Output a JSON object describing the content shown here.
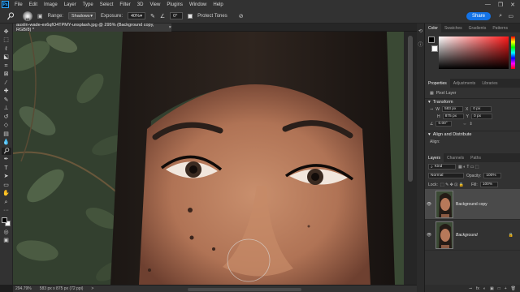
{
  "app": {
    "logo": "Ps"
  },
  "menu": [
    "File",
    "Edit",
    "Image",
    "Layer",
    "Type",
    "Select",
    "Filter",
    "3D",
    "View",
    "Plugins",
    "Window",
    "Help"
  ],
  "window_controls": [
    "—",
    "❐",
    "✕"
  ],
  "options": {
    "brush_size": "65",
    "range_label": "Range:",
    "range_value": "Shadows",
    "exposure_label": "Exposure:",
    "exposure_value": "40%",
    "angle_value": "0°",
    "protect_label": "Protect Tones",
    "share": "Share"
  },
  "tab": {
    "title": "austin-wade-ex6qfO4TPMY-unsplash.jpg @ 295% (Background copy, RGB/8) *",
    "close": "×"
  },
  "status": {
    "zoom": "294.79%",
    "dims": "583 px x 875 px (72 ppi)",
    "arrow": ">"
  },
  "panels": {
    "color_tabs": [
      "Color",
      "Swatches",
      "Gradients",
      "Patterns"
    ],
    "props_tabs": [
      "Properties",
      "Adjustments",
      "Libraries"
    ],
    "pixel_layer": "Pixel Layer",
    "transform": "Transform",
    "w_label": "W",
    "w_value": "583 px",
    "h_label": "H",
    "h_value": "875 px",
    "x_label": "X",
    "x_value": "0 px",
    "y_label": "Y",
    "y_value": "0 px",
    "angle_label": "∠",
    "angle_value": "0.00°",
    "align": "Align and Distribute",
    "align_sub": "Align:",
    "layers_tabs": [
      "Layers",
      "Channels",
      "Paths"
    ],
    "kind": "Kind",
    "blend": "Normal",
    "opacity_label": "Opacity:",
    "opacity": "100%",
    "lock_label": "Lock:",
    "fill_label": "Fill:",
    "fill": "100%",
    "layers": [
      {
        "name": "Background copy",
        "selected": true
      },
      {
        "name": "Background",
        "selected": false
      }
    ],
    "layer_footer": [
      "fx",
      "◐",
      "▣",
      "□",
      "+",
      "🗑"
    ]
  },
  "colors": {
    "accent": "#1473e6",
    "menubar": "#323232",
    "panel": "#323232"
  }
}
